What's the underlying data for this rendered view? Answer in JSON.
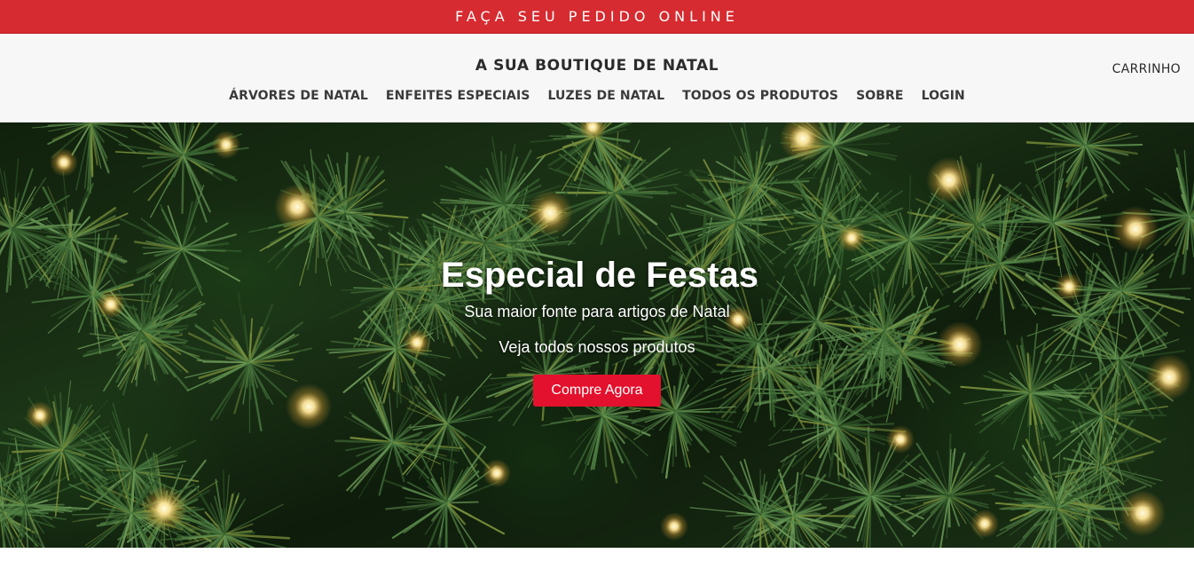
{
  "promo": {
    "text": "FAÇA SEU PEDIDO ONLINE"
  },
  "header": {
    "brand": "A SUA BOUTIQUE DE NATAL",
    "cart_label": "CARRINHO",
    "nav": [
      "ÁRVORES DE NATAL",
      "ENFEITES ESPECIAIS",
      "LUZES DE NATAL",
      "TODOS OS PRODUTOS",
      "SOBRE",
      "LOGIN"
    ]
  },
  "hero": {
    "title": "Especial de Festas",
    "subtitle": "Sua maior fonte para artigos de Natal",
    "link_text": "Veja todos nossos produtos",
    "button_label": "Compre Agora"
  },
  "colors": {
    "promo_bar": "#d62b30",
    "header_bg": "#f7f7f7",
    "cta_button": "#e3112d"
  }
}
